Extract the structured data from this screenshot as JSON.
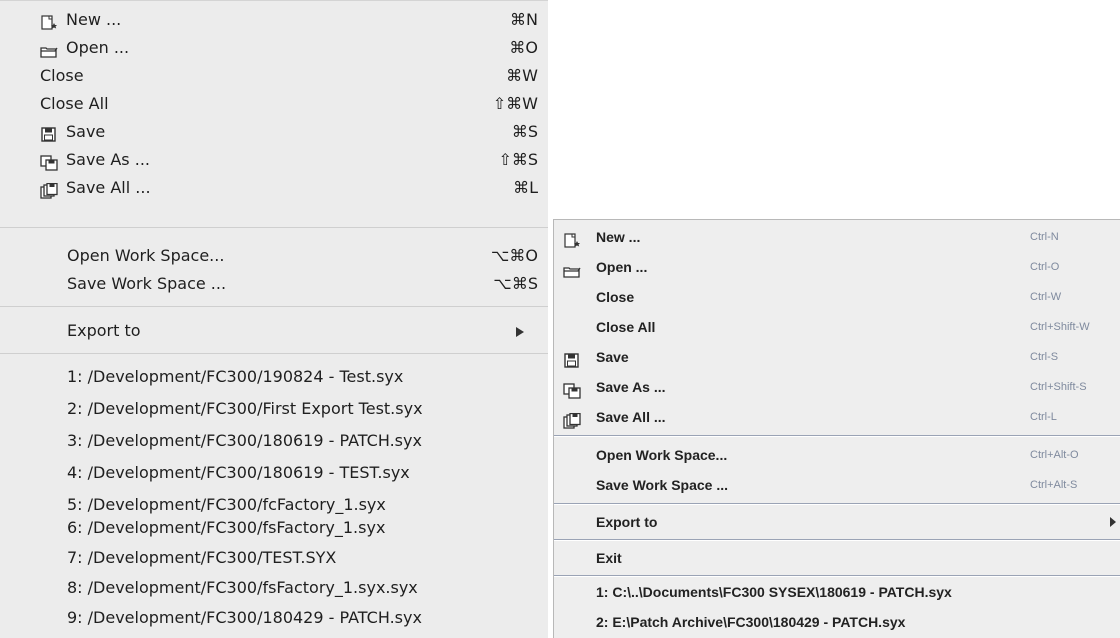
{
  "mac_menu": {
    "items": [
      {
        "label": "New ...",
        "shortcut": "⌘N",
        "icon": "new-document-icon"
      },
      {
        "label": "Open ...",
        "shortcut": "⌘O",
        "icon": "open-folder-icon"
      },
      {
        "label": "Close",
        "shortcut": "⌘W"
      },
      {
        "label": "Close All",
        "shortcut": "⇧⌘W"
      },
      {
        "label": "Save",
        "shortcut": "⌘S",
        "icon": "save-icon"
      },
      {
        "label": "Save As ...",
        "shortcut": "⇧⌘S",
        "icon": "save-as-icon"
      },
      {
        "label": "Save All ...",
        "shortcut": "⌘L",
        "icon": "save-all-icon"
      }
    ],
    "workspace": [
      {
        "label": "Open Work Space...",
        "shortcut": "⌥⌘O"
      },
      {
        "label": "Save Work Space ...",
        "shortcut": "⌥⌘S"
      }
    ],
    "export": {
      "label": "Export to"
    },
    "recent": [
      "1: /Development/FC300/190824 - Test.syx",
      "2: /Development/FC300/First Export Test.syx",
      "3: /Development/FC300/180619 - PATCH.syx",
      "4: /Development/FC300/180619 - TEST.syx",
      "5: /Development/FC300/fcFactory_1.syx",
      "6: /Development/FC300/fsFactory_1.syx",
      "7: /Development/FC300/TEST.SYX",
      "8: /Development/FC300/fsFactory_1.syx.syx",
      "9: /Development/FC300/180429 - PATCH.syx"
    ]
  },
  "win_menu": {
    "items": [
      {
        "label": "New ...",
        "shortcut": "Ctrl-N",
        "icon": "new-document-icon"
      },
      {
        "label": "Open ...",
        "shortcut": "Ctrl-O",
        "icon": "open-folder-icon"
      },
      {
        "label": "Close",
        "shortcut": "Ctrl-W"
      },
      {
        "label": "Close All",
        "shortcut": "Ctrl+Shift-W"
      },
      {
        "label": "Save",
        "shortcut": "Ctrl-S",
        "icon": "save-icon"
      },
      {
        "label": "Save As ...",
        "shortcut": "Ctrl+Shift-S",
        "icon": "save-as-icon"
      },
      {
        "label": "Save All ...",
        "shortcut": "Ctrl-L",
        "icon": "save-all-icon"
      }
    ],
    "workspace": [
      {
        "label": "Open Work Space...",
        "shortcut": "Ctrl+Alt-O"
      },
      {
        "label": "Save Work Space ...",
        "shortcut": "Ctrl+Alt-S"
      }
    ],
    "export": {
      "label": "Export to"
    },
    "exit": {
      "label": "Exit"
    },
    "recent": [
      "1: C:\\..\\Documents\\FC300 SYSEX\\180619 - PATCH.syx",
      "2: E:\\Patch Archive\\FC300\\180429 - PATCH.syx"
    ]
  },
  "colors": {
    "mac_bg": "#ececec",
    "win_bg": "#eeeeee",
    "win_shortcut": "#7f8a9e"
  }
}
